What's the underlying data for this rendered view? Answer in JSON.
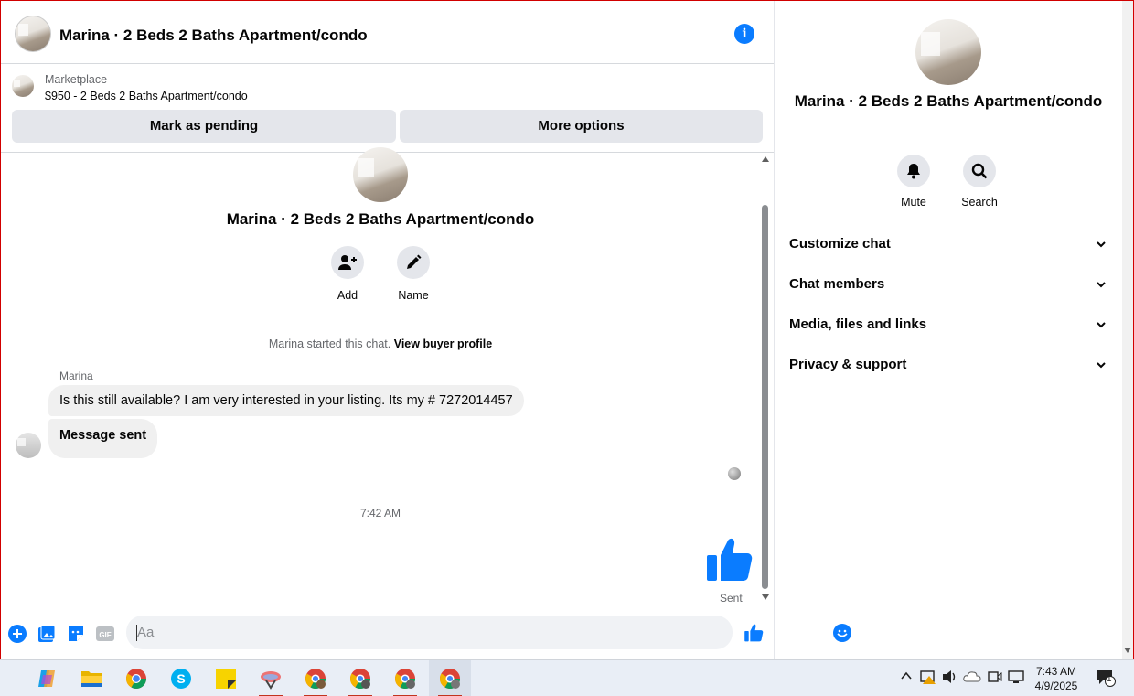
{
  "chat_header": {
    "title": "Marina · 2 Beds 2 Baths Apartment/condo"
  },
  "marketplace": {
    "label": "Marketplace",
    "listing": "$950 - 2 Beds 2 Baths Apartment/condo",
    "pending_button": "Mark as pending",
    "more_button": "More options"
  },
  "thread": {
    "title": "Marina · 2 Beds 2 Baths Apartment/condo",
    "actions": [
      {
        "label": "Add",
        "icon": "add-person-icon"
      },
      {
        "label": "Name",
        "icon": "pencil-icon"
      }
    ],
    "started_text": "Marina started this chat.",
    "buyer_profile_link": "View buyer profile",
    "sender_name": "Marina",
    "messages": [
      "Is this still available? I am very interested in your listing. Its my # 7272014457",
      "Message sent"
    ],
    "timestamp": "7:42 AM",
    "sent_status": "Sent"
  },
  "composer": {
    "placeholder": "Aa"
  },
  "panel": {
    "title": "Marina · 2 Beds 2 Baths Apartment/condo",
    "actions": [
      {
        "label": "Mute",
        "icon": "bell-icon"
      },
      {
        "label": "Search",
        "icon": "search-icon"
      }
    ],
    "sections": [
      "Customize chat",
      "Chat members",
      "Media, files and links",
      "Privacy & support"
    ]
  },
  "taskbar": {
    "time": "7:43 AM",
    "date": "4/9/2025",
    "notification_count": "1",
    "accent": "#0a7cff"
  }
}
